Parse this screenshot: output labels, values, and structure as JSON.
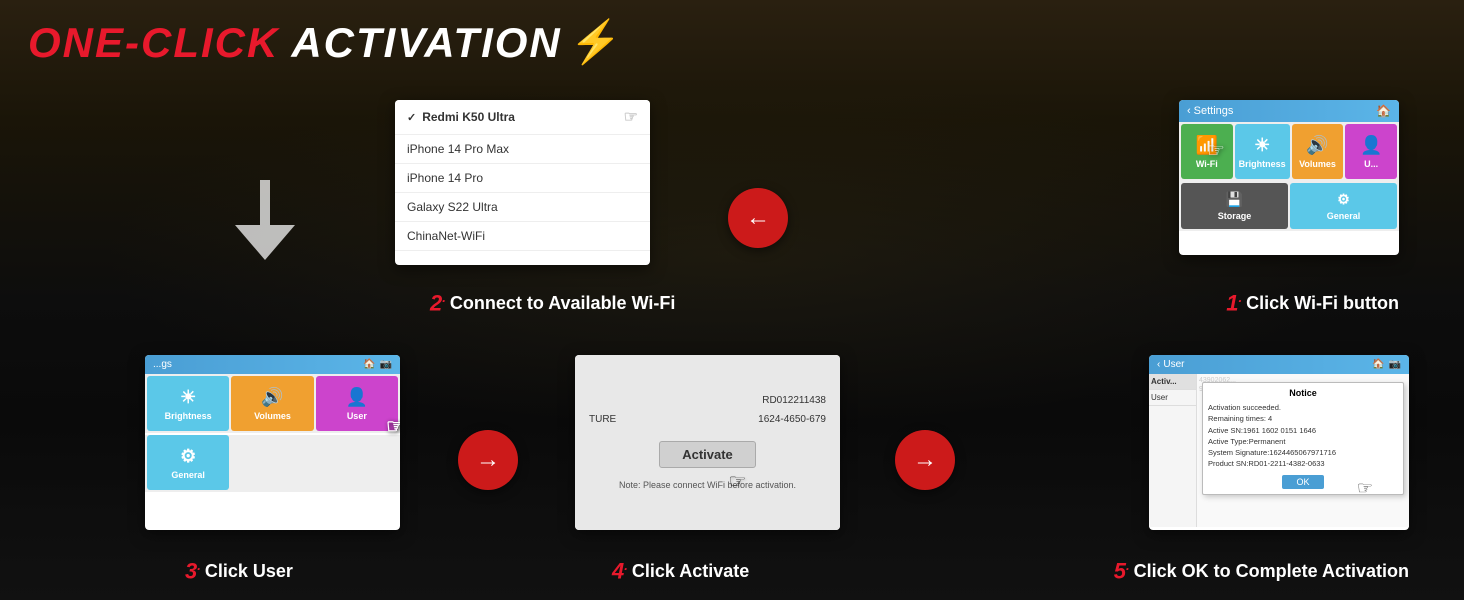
{
  "title": {
    "red_part": "ONE-CLICK",
    "white_part": "ACTIVATION",
    "lightning": "⚡"
  },
  "steps": [
    {
      "number": "1",
      "suffix": ".",
      "label": "Click Wi-Fi button",
      "card_header": "Settings",
      "grid_items": [
        {
          "icon": "📶",
          "label": "Wi-Fi",
          "class": "item-wifi"
        },
        {
          "icon": "☀",
          "label": "Brightness",
          "class": "item-brightness"
        },
        {
          "icon": "🔊",
          "label": "Volumes",
          "class": "item-volume"
        },
        {
          "icon": "👤",
          "label": "U...",
          "class": "item-user"
        },
        {
          "icon": "💾",
          "label": "Storage",
          "class": "item-storage"
        },
        {
          "icon": "⚙",
          "label": "General",
          "class": "item-general"
        }
      ]
    },
    {
      "number": "2",
      "suffix": ".",
      "label": "Connect to Available Wi-Fi",
      "dropdown_items": [
        {
          "text": "Redmi K50 Ultra",
          "selected": true
        },
        {
          "text": "iPhone 14 Pro Max",
          "selected": false
        },
        {
          "text": "iPhone 14 Pro",
          "selected": false
        },
        {
          "text": "Galaxy S22 Ultra",
          "selected": false
        },
        {
          "text": "ChinaNet-WiFi",
          "selected": false
        }
      ]
    },
    {
      "number": "3",
      "suffix": ".",
      "label": "Click User",
      "card_header": "Settings",
      "grid_items": [
        {
          "icon": "☀",
          "label": "Brightness",
          "class": "item-brightness"
        },
        {
          "icon": "🔊",
          "label": "Volumes",
          "class": "item-volume"
        },
        {
          "icon": "👤",
          "label": "User",
          "class": "item-user"
        },
        {
          "icon": "⚙",
          "label": "General",
          "class": "item-general"
        }
      ]
    },
    {
      "number": "4",
      "suffix": ".",
      "label": "Click Activate",
      "serial_label": "RD012211438",
      "signature_label": "1624-4650-679",
      "ture_label": "TURE",
      "activate_button": "Activate",
      "note": "Note: Please connect WiFi before activation."
    },
    {
      "number": "5",
      "suffix": ".",
      "label": "Click OK to Complete Activation",
      "card_header": "User",
      "notice_title": "Notice",
      "notice_lines": [
        "Activation succeeded.",
        "Remaining times: 4",
        "Active SN:1961 1602 0151 1646",
        "Active Type:Permanent",
        "System Signature:1624465067971716",
        "Product SN:RD01-2211-4382-0633"
      ],
      "ok_button": "OK"
    }
  ],
  "nav_arrows": {
    "back": "←",
    "forward": "→"
  }
}
